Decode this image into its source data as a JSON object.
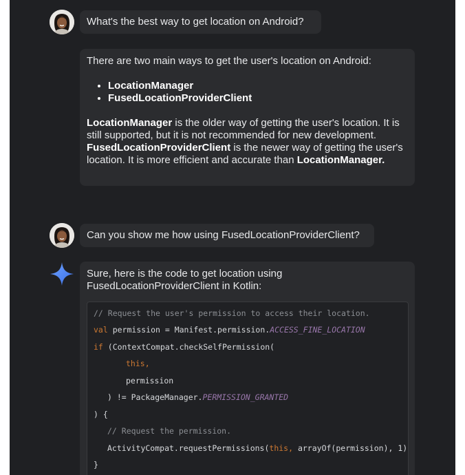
{
  "conversation": {
    "q1": "What's the best way to get location on Android?",
    "a1": {
      "intro": "There are two main ways to get the user's location on Android:",
      "options": [
        "LocationManager",
        "FusedLocationProviderClient"
      ],
      "p1_bold": "LocationManager",
      "p1_rest": " is the older way of getting the user's location. It is still supported, but it is not recommended for new development.",
      "p2_bold": "FusedLocationProviderClient",
      "p2_rest": " is the newer way of getting the user's location. It is more efficient and accurate than",
      "p2_end": "LocationManager."
    },
    "q2": "Can you show me how using FusedLocationProviderClient?",
    "a2": {
      "intro": "Sure, here is the code to get location using FusedLocationProviderClient in Kotlin:"
    }
  },
  "code": {
    "l1": "// Request the user's permission to access their location.",
    "l2_kw": "val",
    "l2_a": " permission = Manifest.permission.",
    "l2_const": "ACCESS_FINE_LOCATION",
    "l3_kw": "if",
    "l3_a": " (ContextCompat.checkSelfPermission(",
    "l4": "this,",
    "l5": "permission",
    "l6_a": ") != PackageManager.",
    "l6_const": "PERMISSION_GRANTED",
    "l7": ") {",
    "l8": "// Request the permission.",
    "l9_a": "ActivityCompat.requestPermissions(",
    "l9_kw": "this,",
    "l9_b": " arrayOf(permission), 1)",
    "l10": "}"
  },
  "colors": {
    "background": "#1f2023",
    "bubble": "#2b2c2f",
    "gemini_blue": "#4f8df7"
  },
  "icons": {
    "user": "user-avatar",
    "assistant": "gemini-sparkle-icon"
  }
}
